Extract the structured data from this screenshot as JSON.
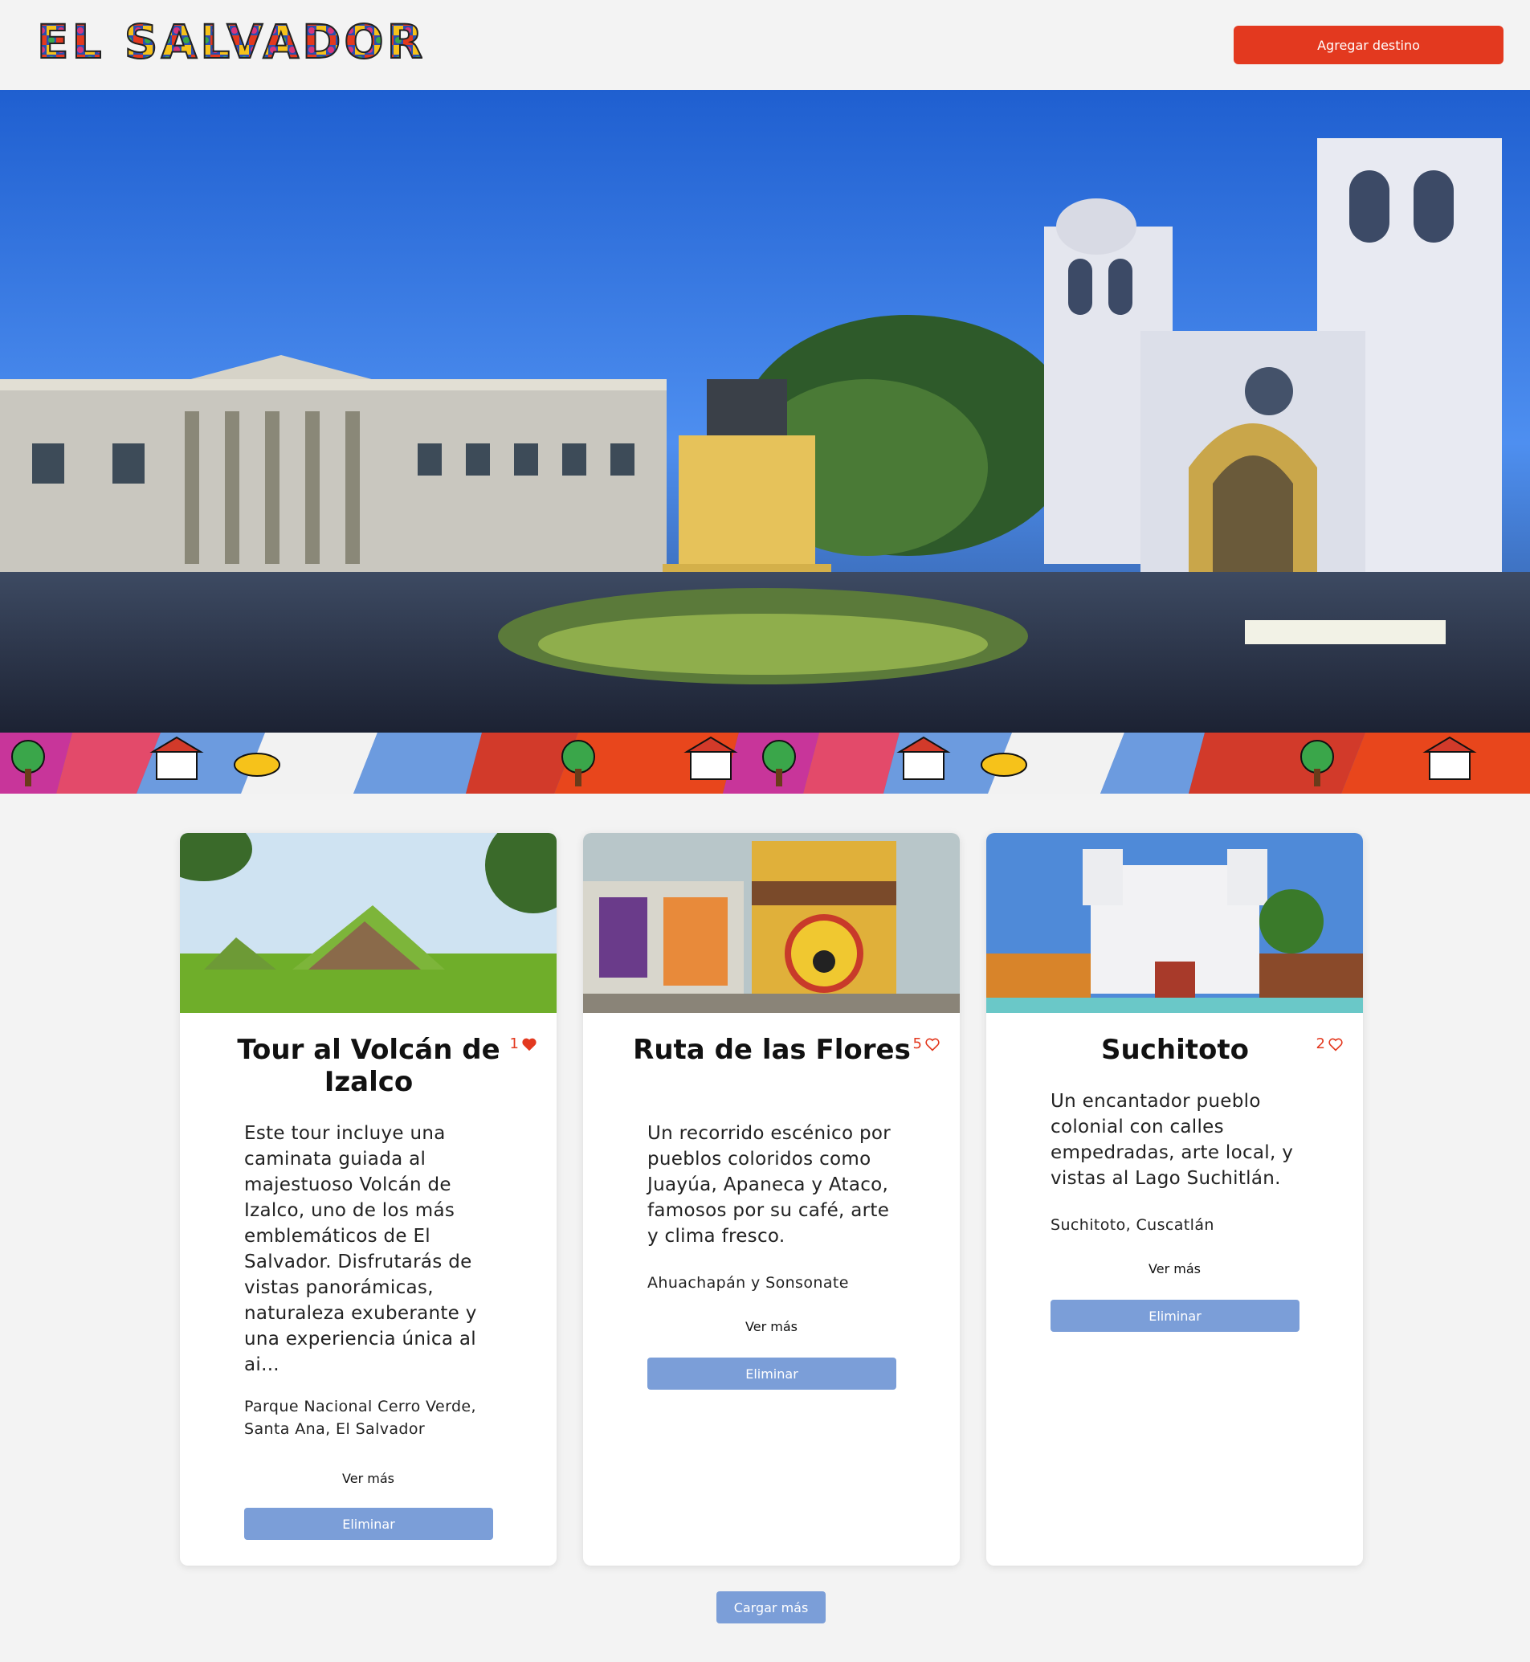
{
  "header": {
    "logo_text": "EL SALVADOR",
    "add_button_label": "Agregar destino"
  },
  "cards": [
    {
      "title": "Tour al Volcán de Izalco",
      "likes": "1",
      "liked": true,
      "description": "Este tour incluye una caminata guiada al majestuoso Volcán de Izalco, uno de los más emblemáticos de El Salvador. Disfrutarás de vistas panorámicas, naturaleza exuberante y una experiencia única al ai...",
      "location": "Parque Nacional Cerro Verde, Santa Ana, El Salvador",
      "more_label": "Ver más",
      "delete_label": "Eliminar"
    },
    {
      "title": "Ruta de las Flores",
      "likes": "5",
      "liked": false,
      "description": "Un recorrido escénico por pueblos coloridos como Juayúa, Apaneca y Ataco, famosos por su café, arte y clima fresco.",
      "location": "Ahuachapán y Sonsonate",
      "more_label": "Ver más",
      "delete_label": "Eliminar"
    },
    {
      "title": "Suchitoto",
      "likes": "2",
      "liked": false,
      "description": "Un encantador pueblo colonial con calles empedradas, arte local, y vistas al Lago Suchitlán.",
      "location": "Suchitoto, Cuscatlán",
      "more_label": "Ver más",
      "delete_label": "Eliminar"
    }
  ],
  "load_more_label": "Cargar más",
  "colors": {
    "accent_red": "#e3391f",
    "button_blue": "#7b9ed8",
    "background": "#f3f3f3"
  }
}
